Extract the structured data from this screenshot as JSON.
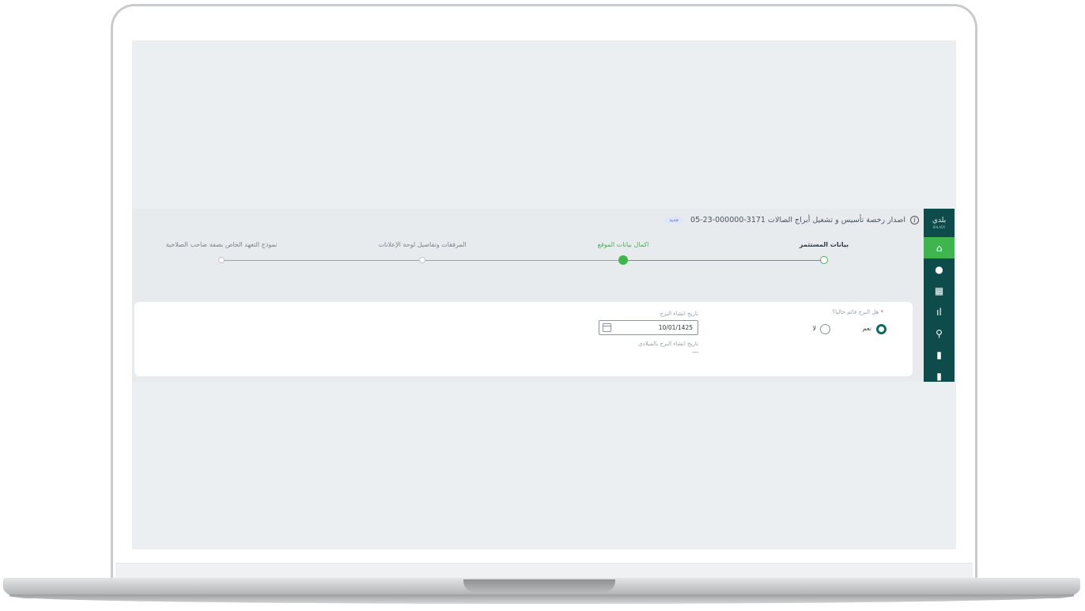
{
  "header": {
    "title": "اصدار رخصة تأسيس و تشغيل أبراج الصالات 3171-000000-23-05",
    "badge": "جديد",
    "info_icon": "info-icon"
  },
  "sidebar": {
    "logo": "بلدي",
    "logo_sub": "BALADY",
    "items": [
      {
        "icon": "home-icon",
        "glyph": "⌂",
        "active": true
      },
      {
        "icon": "globe-icon",
        "glyph": "●",
        "active": false
      },
      {
        "icon": "grid-icon",
        "glyph": "▦",
        "active": false
      },
      {
        "icon": "chart-icon",
        "glyph": "ıl",
        "active": false
      },
      {
        "icon": "search-icon",
        "glyph": "⚲",
        "active": false
      },
      {
        "icon": "document-icon",
        "glyph": "▮",
        "active": false
      },
      {
        "icon": "document-icon",
        "glyph": "▮",
        "active": false
      }
    ]
  },
  "stepper": {
    "steps": [
      {
        "label": "بيانات المستثمر",
        "state": "done"
      },
      {
        "label": "اكمال بيانات الموقع",
        "state": "current"
      },
      {
        "label": "المرفقات وتفاصيل لوحة الإعلانات",
        "state": "pending"
      },
      {
        "label": "نموذج التعهد الخاص بصفة صاحب الصلاحية",
        "state": "pending"
      }
    ],
    "colors": {
      "done": "#3fb54e",
      "pending": "#9aa1a9",
      "current_dot": "#3fb54e"
    }
  },
  "form": {
    "question_label": "هل البرج قائم حاليا؟",
    "required_mark": "*",
    "options": [
      {
        "label": "نعم",
        "selected": true
      },
      {
        "label": "لا",
        "selected": false
      }
    ],
    "build_date_label": "تاريخ انشاء البرج",
    "build_date_value": "10/01/1425",
    "build_date_greg_label": "تاريخ انشاء البرج بالميلادي",
    "build_date_greg_value": "---"
  }
}
